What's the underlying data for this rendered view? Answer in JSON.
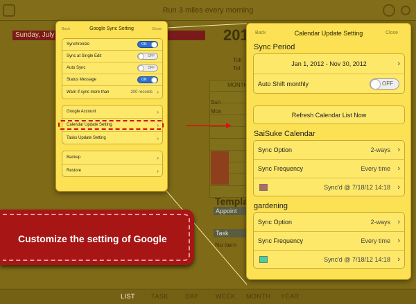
{
  "background": {
    "top_title": "Run 3 miles every morning",
    "date_bar": "Sunday, July 1",
    "year_fragment": "201",
    "small_labels": [
      "Tok",
      "Tel",
      "MONTH",
      "Sun",
      "Mon"
    ],
    "template_heading": "Templat",
    "appointment_label": "Appoint",
    "task_label": "Task",
    "no_items": "No item",
    "tabs": [
      "LIST",
      "TASK",
      "DAY",
      "WEEK",
      "MONTH",
      "YEAR"
    ],
    "active_tab": "LIST"
  },
  "google_sync": {
    "title": "Google Sync Setting",
    "back": "Back",
    "close": "Close",
    "group1": [
      {
        "label": "Synchronize",
        "toggle": "ON"
      },
      {
        "label": "Sync at Single Edit",
        "toggle": "OFF"
      },
      {
        "label": "Auto Sync",
        "toggle": "OFF"
      },
      {
        "label": "Status Message",
        "toggle": "ON"
      },
      {
        "label": "Warn if sync more than",
        "value": "200 records"
      }
    ],
    "group2": [
      "Google Account",
      "Calendar Update Setting",
      "Tasks Update Setting"
    ],
    "group3": [
      "Backup",
      "Restore"
    ]
  },
  "calendar_update": {
    "title": "Calendar Update Setting",
    "back": "Back",
    "close": "Close",
    "sync_period_heading": "Sync Period",
    "sync_period_value": "Jan 1, 2012 - Nov 30, 2012",
    "auto_shift_label": "Auto Shift monthly",
    "auto_shift_toggle": "OFF",
    "refresh_button": "Refresh Calendar List Now",
    "calendars": [
      {
        "name": "SaiSuke Calendar",
        "option_label": "Sync Option",
        "option_value": "2-ways",
        "frequency_label": "Sync Frequency",
        "frequency_value": "Every time",
        "status": "Sync'd @ 7/18/12 14:18",
        "color": "#b36a5c"
      },
      {
        "name": "gardening",
        "option_label": "Sync Option",
        "option_value": "2-ways",
        "frequency_label": "Sync Frequency",
        "frequency_value": "Every time",
        "status": "Sync'd @ 7/18/12 14:18",
        "color": "#3fd49a"
      }
    ]
  },
  "banner": {
    "text": "Customize the setting of Google"
  },
  "colors": {
    "panel": "#fbe153",
    "highlight": "#d01010",
    "banner": "#a81515",
    "toggle_on": "#2f6fd0"
  }
}
